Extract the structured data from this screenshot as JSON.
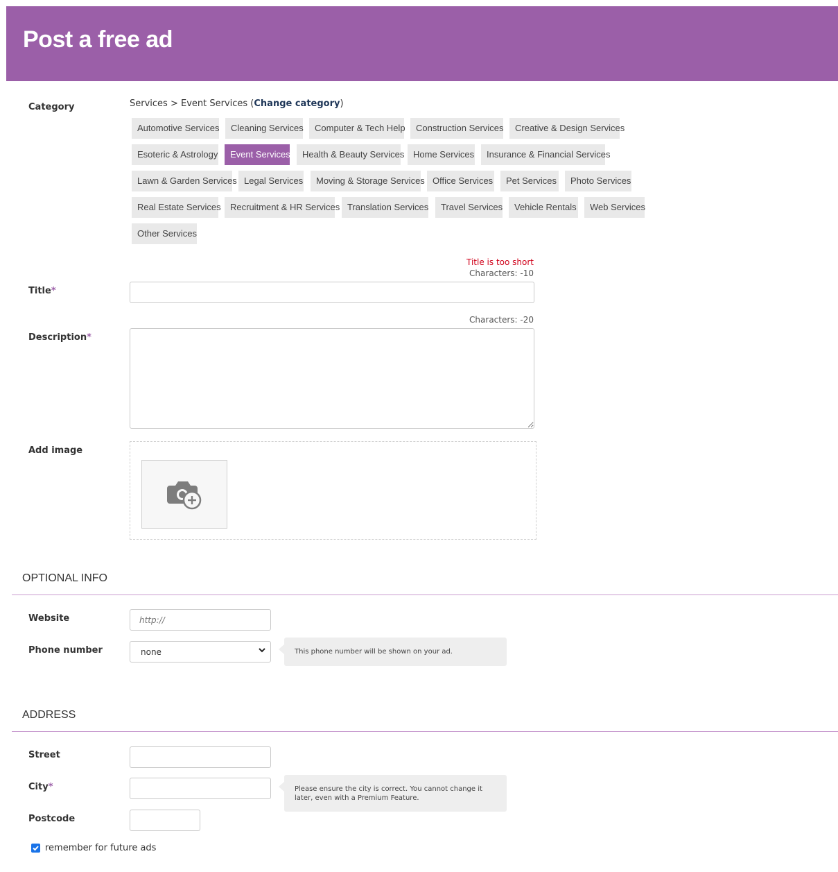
{
  "header": {
    "title": "Post a free ad"
  },
  "category": {
    "label": "Category",
    "breadcrumb_path": "Services > Event Services (",
    "change_link": "Change category",
    "breadcrumb_close": ")",
    "tags": [
      "Automotive Services",
      "Cleaning Services",
      "Computer & Tech Help",
      "Construction Services",
      "Creative & Design Services",
      "Esoteric & Astrology",
      "Event Services",
      "Health & Beauty Services",
      "Home Services",
      "Insurance & Financial Services",
      "Lawn & Garden Services",
      "Legal Services",
      "Moving & Storage Services",
      "Office Services",
      "Pet Services",
      "Photo Services",
      "Real Estate Services",
      "Recruitment & HR Services",
      "Translation Services",
      "Travel Services",
      "Vehicle Rentals",
      "Web Services",
      "Other Services"
    ],
    "selected": "Event Services"
  },
  "title_field": {
    "label": "Title",
    "required_mark": "*",
    "error": "Title is too short",
    "counter": "Characters: -10",
    "value": ""
  },
  "description_field": {
    "label": "Description",
    "required_mark": "*",
    "counter": "Characters: -20",
    "value": ""
  },
  "image": {
    "label": "Add image",
    "icon": "camera-add-icon"
  },
  "optional_info": {
    "heading": "OPTIONAL INFO",
    "website_label": "Website",
    "website_placeholder": "http://",
    "phone_label": "Phone number",
    "phone_value": "none",
    "phone_hint": "This phone number will be shown on your ad."
  },
  "address": {
    "heading": "ADDRESS",
    "street_label": "Street",
    "city_label": "City",
    "city_required_mark": "*",
    "city_hint": "Please ensure the city is correct. You cannot change it later, even with a Premium Feature.",
    "postcode_label": "Postcode",
    "remember_label": "remember for future ads",
    "remember_checked": true
  },
  "colors": {
    "accent": "#9b5fa8",
    "error": "#d0021b",
    "tag_bg": "#e9e9e9"
  }
}
